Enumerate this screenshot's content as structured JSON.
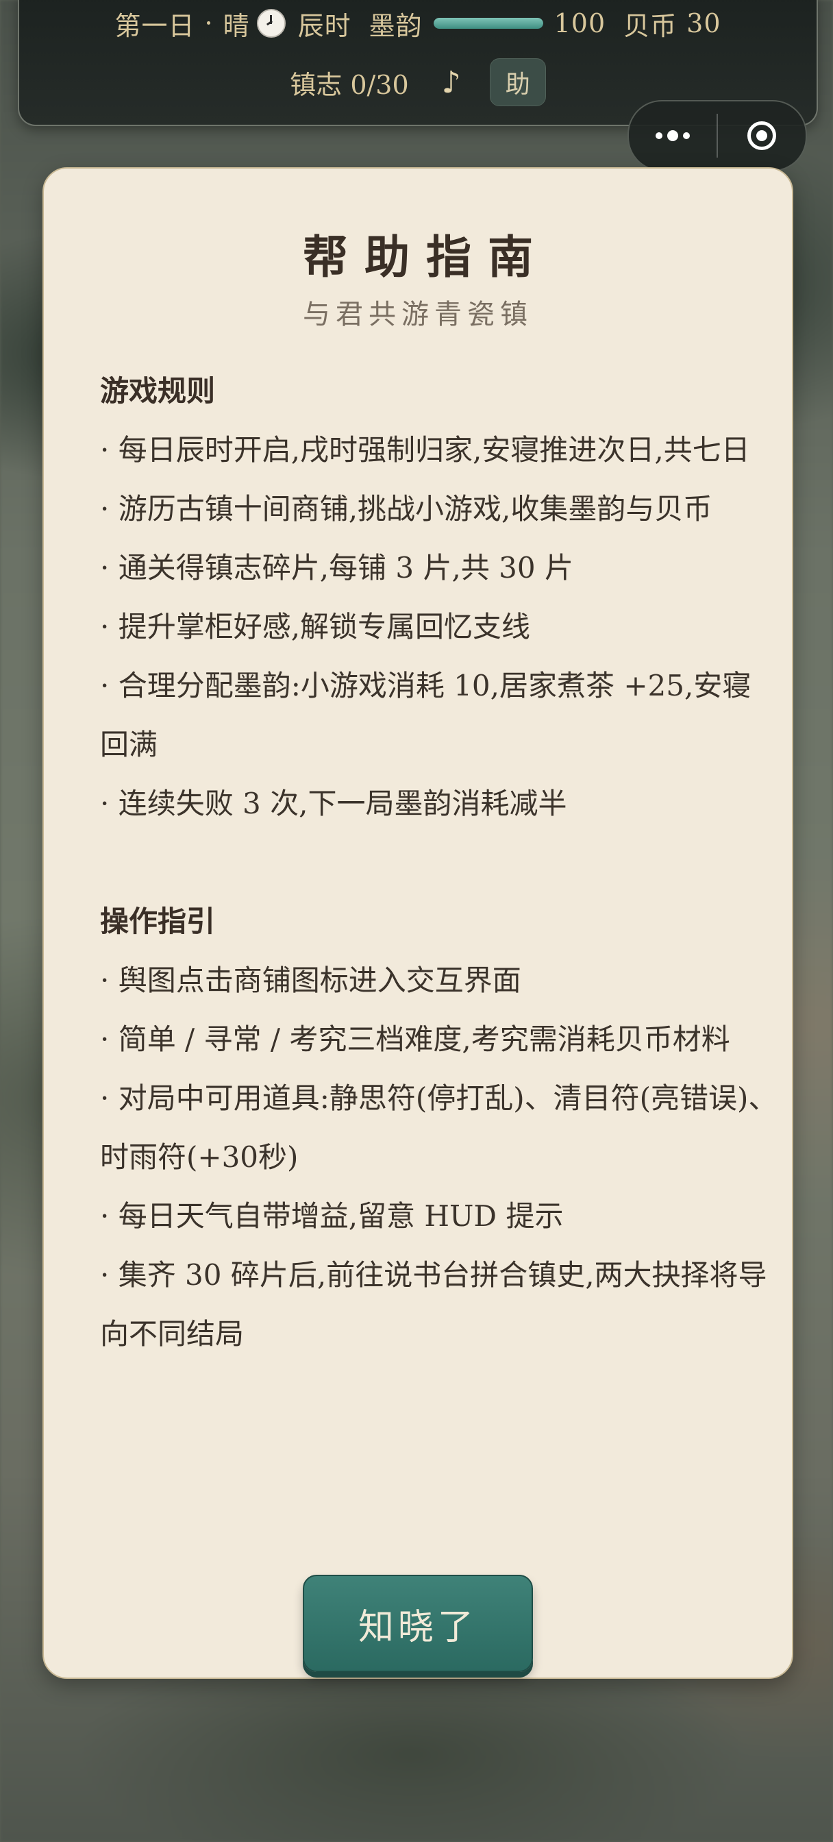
{
  "hud": {
    "day": "第一日",
    "dot": "·",
    "weather": "晴",
    "clock_icon": "clock-icon",
    "time": "辰时",
    "ink_label": "墨韵",
    "ink_value": "100",
    "ink_fill_fraction": 1.0,
    "ink_color": "#4f9e91",
    "coin_label": "贝币",
    "coin_value": "30",
    "chronicle": "镇志 0/30",
    "music_icon": "♪",
    "help_label": "助"
  },
  "capsule": {
    "more_icon": "more-icon",
    "close_icon": "target-close-icon"
  },
  "panel": {
    "title": "帮助指南",
    "subtitle": "与君共游青瓷镇",
    "sections": [
      {
        "title": "游戏规则",
        "items": [
          "· 每日辰时开启,戌时强制归家,安寝推进次日,共七日",
          "· 游历古镇十间商铺,挑战小游戏,收集墨韵与贝币",
          "· 通关得镇志碎片,每铺 3 片,共 30 片",
          "· 提升掌柜好感,解锁专属回忆支线",
          "· 合理分配墨韵:小游戏消耗 10,居家煮茶 +25,安寝回满",
          "· 连续失败 3 次,下一局墨韵消耗减半"
        ]
      },
      {
        "title": "操作指引",
        "items": [
          "· 舆图点击商铺图标进入交互界面",
          "· 简单 / 寻常 / 考究三档难度,考究需消耗贝币材料",
          "· 对局中可用道具:静思符(停打乱)、清目符(亮错误)、时雨符(+30秒)",
          "· 每日天气自带增益,留意 HUD 提示",
          "· 集齐 30 碎片后,前往说书台拼合镇史,两大抉择将导向不同结局"
        ]
      }
    ],
    "ok_button": "知晓了"
  },
  "colors": {
    "panel_bg": "#f2eadb",
    "hud_bg": "#1f2523",
    "hud_text": "#d8c79c",
    "button_teal": "#2f7168"
  }
}
